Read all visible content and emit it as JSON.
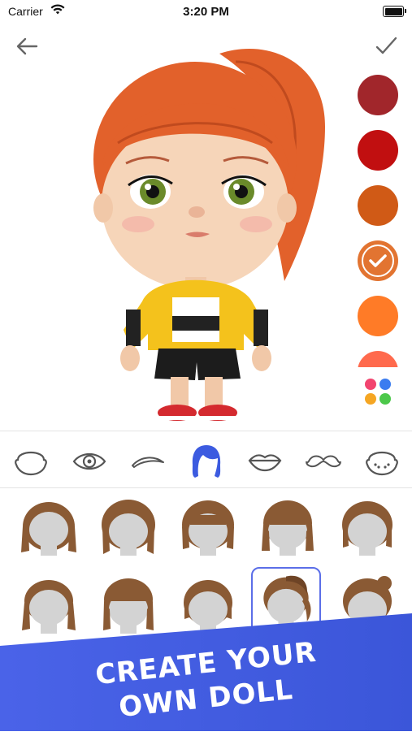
{
  "status_bar": {
    "carrier": "Carrier",
    "time": "3:20 PM"
  },
  "toolbar": {
    "back_icon": "arrow-left-icon",
    "confirm_icon": "checkmark-icon"
  },
  "colors": {
    "swatches": [
      "#A1262B",
      "#C10F10",
      "#D05A16",
      "#E27431",
      "#FF7B27",
      "#FF6A4D"
    ],
    "selected_index": 3,
    "accent": "#3C5BE0"
  },
  "features": [
    "face-shape-icon",
    "eye-icon",
    "eyebrow-icon",
    "hair-icon",
    "lips-icon",
    "mustache-icon",
    "freckles-icon"
  ],
  "selected_feature": "hair-icon",
  "hair_options_selected_index": 8,
  "banner": {
    "line1": "CREATE YOUR",
    "line2": "OWN DOLL"
  }
}
